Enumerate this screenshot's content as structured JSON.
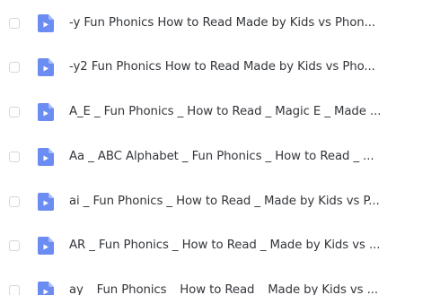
{
  "file_list": {
    "items": [
      {
        "name": "-y  Fun Phonics How to Read Made by Kids vs Phon...",
        "icon": "video-file-icon"
      },
      {
        "name": "-y2 Fun Phonics  How to Read Made by Kids vs Pho...",
        "icon": "video-file-icon"
      },
      {
        "name": "A_E _ Fun Phonics _ How to Read _ Magic E _ Made ...",
        "icon": "video-file-icon"
      },
      {
        "name": "Aa _ ABC Alphabet _ Fun Phonics _ How to Read _ ...",
        "icon": "video-file-icon"
      },
      {
        "name": "ai _ Fun Phonics _ How to Read _ Made by Kids vs P...",
        "icon": "video-file-icon"
      },
      {
        "name": "AR _ Fun Phonics _ How to Read _ Made by Kids vs ...",
        "icon": "video-file-icon"
      },
      {
        "name": "ay _ Fun Phonics _ How to Read _ Made by Kids vs ...",
        "icon": "video-file-icon"
      }
    ]
  },
  "colors": {
    "icon_fill": "#6b8cf2",
    "icon_fold": "#a9bdf7",
    "text": "#33363b",
    "checkbox_border": "#d3d6dc"
  }
}
